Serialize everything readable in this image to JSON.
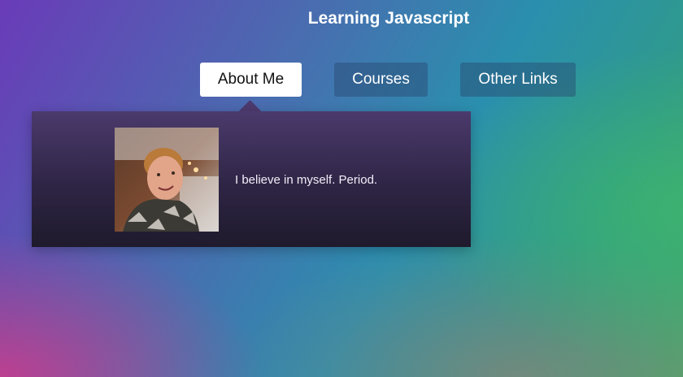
{
  "header": {
    "title": "Learning Javascript"
  },
  "nav": {
    "tabs": [
      {
        "label": "About Me",
        "active": true
      },
      {
        "label": "Courses",
        "active": false
      },
      {
        "label": "Other Links",
        "active": false
      }
    ]
  },
  "about_panel": {
    "bio": "I believe in myself. Period."
  }
}
